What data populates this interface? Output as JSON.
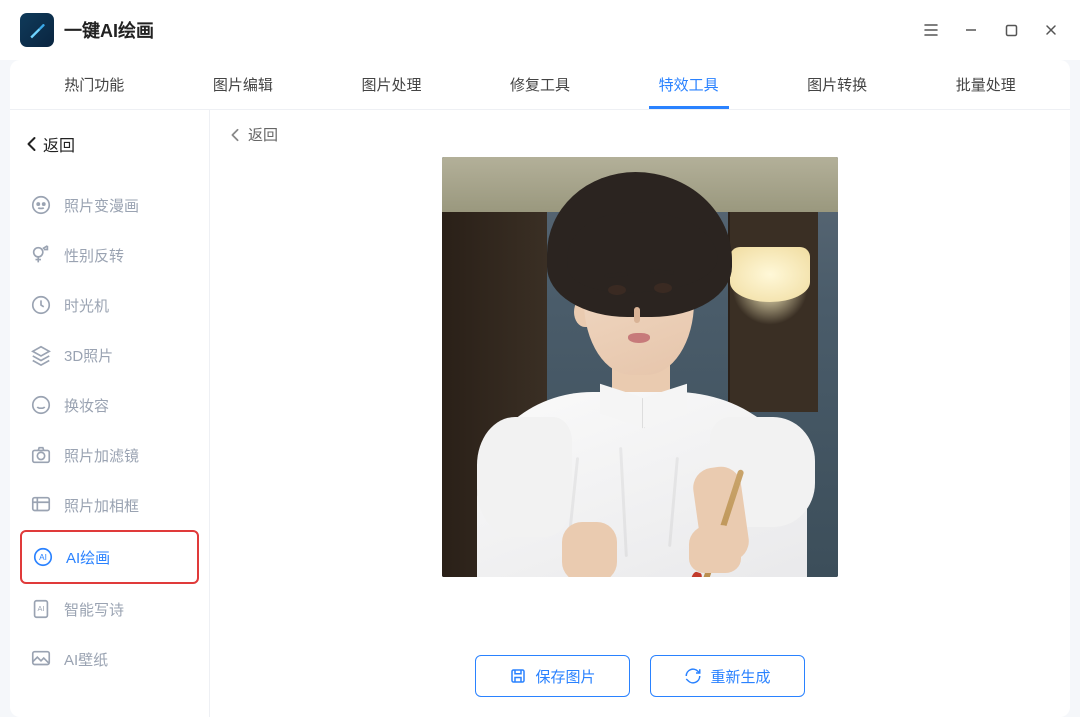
{
  "app": {
    "title": "一键AI绘画"
  },
  "tabs": [
    "热门功能",
    "图片编辑",
    "图片处理",
    "修复工具",
    "特效工具",
    "图片转换",
    "批量处理"
  ],
  "active_tab_index": 4,
  "sidebar_back": "返回",
  "sidebar_items": [
    {
      "label": "照片变漫画"
    },
    {
      "label": "性别反转"
    },
    {
      "label": "时光机"
    },
    {
      "label": "3D照片"
    },
    {
      "label": "换妆容"
    },
    {
      "label": "照片加滤镜"
    },
    {
      "label": "照片加相框"
    },
    {
      "label": "AI绘画"
    },
    {
      "label": "智能写诗"
    },
    {
      "label": "AI壁纸"
    }
  ],
  "active_sidebar_index": 7,
  "main_back": "返回",
  "actions": {
    "save": "保存图片",
    "regenerate": "重新生成"
  }
}
